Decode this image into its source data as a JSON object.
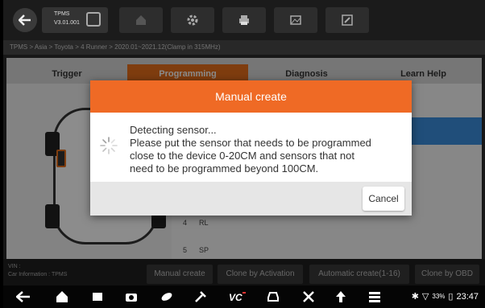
{
  "app": {
    "name": "TPMS",
    "version": "V3.01.001"
  },
  "breadcrumb": "TPMS > Asia > Toyota > 4 Runner > 2020.01~2021.12(Clamp in 315MHz)",
  "tabs": [
    {
      "label": "Trigger",
      "active": false
    },
    {
      "label": "Programming",
      "active": true
    },
    {
      "label": "Diagnosis",
      "active": false
    },
    {
      "label": "Learn Help",
      "active": false
    }
  ],
  "list_rows": [
    {
      "index": "4",
      "position": "RL"
    },
    {
      "index": "5",
      "position": "SP"
    }
  ],
  "dialog": {
    "title": "Manual create",
    "lines": [
      "Detecting sensor...",
      "Please put the sensor that needs to be programmed",
      "close to the device 0-20CM and sensors that not",
      "need to be programmed beyond 100CM."
    ],
    "cancel_label": "Cancel"
  },
  "footer": {
    "vin_label": "VIN :",
    "car_info": "Car Information : TPMS",
    "buttons": [
      "Manual create",
      "Clone by Activation",
      "Automatic create(1-16)",
      "Clone by OBD"
    ]
  },
  "status_bar": {
    "battery": "33%",
    "time": "23:47"
  },
  "colors": {
    "accent": "#ef6a25",
    "highlight": "#3b8fdf"
  }
}
